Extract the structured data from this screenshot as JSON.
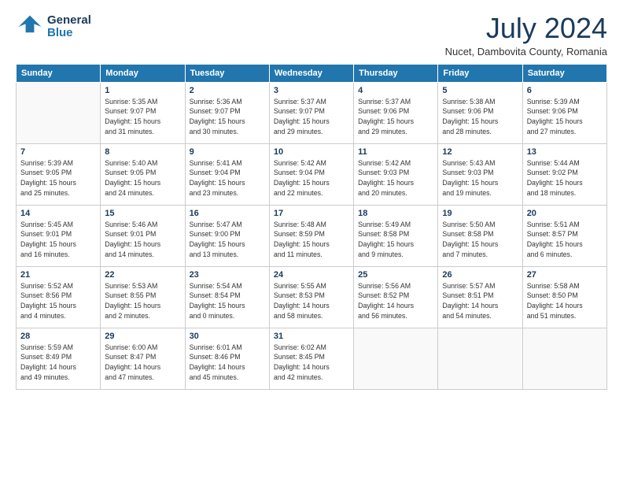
{
  "header": {
    "logo_line1": "General",
    "logo_line2": "Blue",
    "month": "July 2024",
    "location": "Nucet, Dambovita County, Romania"
  },
  "weekdays": [
    "Sunday",
    "Monday",
    "Tuesday",
    "Wednesday",
    "Thursday",
    "Friday",
    "Saturday"
  ],
  "weeks": [
    [
      {
        "day": "",
        "info": ""
      },
      {
        "day": "1",
        "info": "Sunrise: 5:35 AM\nSunset: 9:07 PM\nDaylight: 15 hours\nand 31 minutes."
      },
      {
        "day": "2",
        "info": "Sunrise: 5:36 AM\nSunset: 9:07 PM\nDaylight: 15 hours\nand 30 minutes."
      },
      {
        "day": "3",
        "info": "Sunrise: 5:37 AM\nSunset: 9:07 PM\nDaylight: 15 hours\nand 29 minutes."
      },
      {
        "day": "4",
        "info": "Sunrise: 5:37 AM\nSunset: 9:06 PM\nDaylight: 15 hours\nand 29 minutes."
      },
      {
        "day": "5",
        "info": "Sunrise: 5:38 AM\nSunset: 9:06 PM\nDaylight: 15 hours\nand 28 minutes."
      },
      {
        "day": "6",
        "info": "Sunrise: 5:39 AM\nSunset: 9:06 PM\nDaylight: 15 hours\nand 27 minutes."
      }
    ],
    [
      {
        "day": "7",
        "info": "Sunrise: 5:39 AM\nSunset: 9:05 PM\nDaylight: 15 hours\nand 25 minutes."
      },
      {
        "day": "8",
        "info": "Sunrise: 5:40 AM\nSunset: 9:05 PM\nDaylight: 15 hours\nand 24 minutes."
      },
      {
        "day": "9",
        "info": "Sunrise: 5:41 AM\nSunset: 9:04 PM\nDaylight: 15 hours\nand 23 minutes."
      },
      {
        "day": "10",
        "info": "Sunrise: 5:42 AM\nSunset: 9:04 PM\nDaylight: 15 hours\nand 22 minutes."
      },
      {
        "day": "11",
        "info": "Sunrise: 5:42 AM\nSunset: 9:03 PM\nDaylight: 15 hours\nand 20 minutes."
      },
      {
        "day": "12",
        "info": "Sunrise: 5:43 AM\nSunset: 9:03 PM\nDaylight: 15 hours\nand 19 minutes."
      },
      {
        "day": "13",
        "info": "Sunrise: 5:44 AM\nSunset: 9:02 PM\nDaylight: 15 hours\nand 18 minutes."
      }
    ],
    [
      {
        "day": "14",
        "info": "Sunrise: 5:45 AM\nSunset: 9:01 PM\nDaylight: 15 hours\nand 16 minutes."
      },
      {
        "day": "15",
        "info": "Sunrise: 5:46 AM\nSunset: 9:01 PM\nDaylight: 15 hours\nand 14 minutes."
      },
      {
        "day": "16",
        "info": "Sunrise: 5:47 AM\nSunset: 9:00 PM\nDaylight: 15 hours\nand 13 minutes."
      },
      {
        "day": "17",
        "info": "Sunrise: 5:48 AM\nSunset: 8:59 PM\nDaylight: 15 hours\nand 11 minutes."
      },
      {
        "day": "18",
        "info": "Sunrise: 5:49 AM\nSunset: 8:58 PM\nDaylight: 15 hours\nand 9 minutes."
      },
      {
        "day": "19",
        "info": "Sunrise: 5:50 AM\nSunset: 8:58 PM\nDaylight: 15 hours\nand 7 minutes."
      },
      {
        "day": "20",
        "info": "Sunrise: 5:51 AM\nSunset: 8:57 PM\nDaylight: 15 hours\nand 6 minutes."
      }
    ],
    [
      {
        "day": "21",
        "info": "Sunrise: 5:52 AM\nSunset: 8:56 PM\nDaylight: 15 hours\nand 4 minutes."
      },
      {
        "day": "22",
        "info": "Sunrise: 5:53 AM\nSunset: 8:55 PM\nDaylight: 15 hours\nand 2 minutes."
      },
      {
        "day": "23",
        "info": "Sunrise: 5:54 AM\nSunset: 8:54 PM\nDaylight: 15 hours\nand 0 minutes."
      },
      {
        "day": "24",
        "info": "Sunrise: 5:55 AM\nSunset: 8:53 PM\nDaylight: 14 hours\nand 58 minutes."
      },
      {
        "day": "25",
        "info": "Sunrise: 5:56 AM\nSunset: 8:52 PM\nDaylight: 14 hours\nand 56 minutes."
      },
      {
        "day": "26",
        "info": "Sunrise: 5:57 AM\nSunset: 8:51 PM\nDaylight: 14 hours\nand 54 minutes."
      },
      {
        "day": "27",
        "info": "Sunrise: 5:58 AM\nSunset: 8:50 PM\nDaylight: 14 hours\nand 51 minutes."
      }
    ],
    [
      {
        "day": "28",
        "info": "Sunrise: 5:59 AM\nSunset: 8:49 PM\nDaylight: 14 hours\nand 49 minutes."
      },
      {
        "day": "29",
        "info": "Sunrise: 6:00 AM\nSunset: 8:47 PM\nDaylight: 14 hours\nand 47 minutes."
      },
      {
        "day": "30",
        "info": "Sunrise: 6:01 AM\nSunset: 8:46 PM\nDaylight: 14 hours\nand 45 minutes."
      },
      {
        "day": "31",
        "info": "Sunrise: 6:02 AM\nSunset: 8:45 PM\nDaylight: 14 hours\nand 42 minutes."
      },
      {
        "day": "",
        "info": ""
      },
      {
        "day": "",
        "info": ""
      },
      {
        "day": "",
        "info": ""
      }
    ]
  ]
}
